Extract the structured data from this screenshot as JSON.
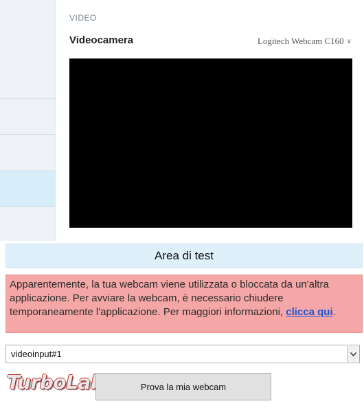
{
  "video_panel": {
    "section_label": "VIDEO",
    "title": "Videocamera",
    "camera_device": "Logitech Webcam C160"
  },
  "test_area": {
    "banner": "Area di test",
    "error_text": "Apparentemente, la tua webcam viene utilizzata o bloccata da un'altra applicazione. Per avviare la webcam, è necessario chiudere temporaneamente l'applicazione. Per maggiori informazioni, ",
    "error_link": "clicca qui",
    "error_tail": ".",
    "device_select_value": "videoinput#1",
    "test_button_label": "Prova la mia webcam"
  },
  "watermark": {
    "text": "TurboLab.it"
  },
  "colors": {
    "error_bg": "#f5a7a7",
    "banner_bg": "#def1fb",
    "selected_sidebar": "#d6eef9",
    "link": "#1a55d6"
  }
}
